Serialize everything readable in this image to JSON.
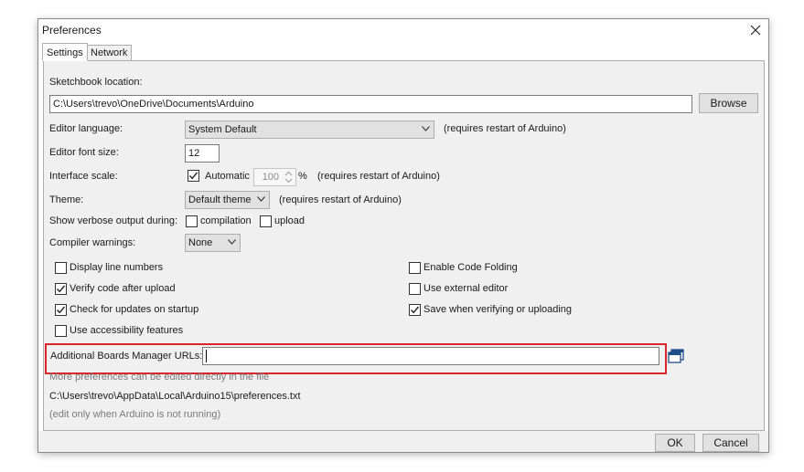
{
  "window": {
    "title": "Preferences"
  },
  "tabs": {
    "settings": "Settings",
    "network": "Network"
  },
  "sketchbook": {
    "label": "Sketchbook location:",
    "path": "C:\\Users\\trevo\\OneDrive\\Documents\\Arduino",
    "browse_label": "Browse"
  },
  "language": {
    "label": "Editor language:",
    "value": "System Default",
    "note": "(requires restart of Arduino)"
  },
  "font_size": {
    "label": "Editor font size:",
    "value": "12"
  },
  "interface_scale": {
    "label": "Interface scale:",
    "automatic_label": "Automatic",
    "automatic_checked": true,
    "value": "100",
    "unit": "%",
    "note": "(requires restart of Arduino)"
  },
  "theme": {
    "label": "Theme:",
    "value": "Default theme",
    "note": "(requires restart of Arduino)"
  },
  "verbose": {
    "label": "Show verbose output during:",
    "compilation_label": "compilation",
    "compilation_checked": false,
    "upload_label": "upload",
    "upload_checked": false
  },
  "warnings": {
    "label": "Compiler warnings:",
    "value": "None"
  },
  "options": {
    "display_line_numbers": {
      "label": "Display line numbers",
      "checked": false
    },
    "verify_after_upload": {
      "label": "Verify code after upload",
      "checked": true
    },
    "check_updates": {
      "label": "Check for updates on startup",
      "checked": true
    },
    "accessibility": {
      "label": "Use accessibility features",
      "checked": false
    },
    "code_folding": {
      "label": "Enable Code Folding",
      "checked": false
    },
    "external_editor": {
      "label": "Use external editor",
      "checked": false
    },
    "save_when_verifying": {
      "label": "Save when verifying or uploading",
      "checked": true
    }
  },
  "boards_manager": {
    "label": "Additional Boards Manager URLs:",
    "value": "",
    "icon": "window-list-icon"
  },
  "more_prefs": {
    "note": "More preferences can be edited directly in the file",
    "path": "C:\\Users\\trevo\\AppData\\Local\\Arduino15\\preferences.txt",
    "warning": "(edit only when Arduino is not running)"
  },
  "footer": {
    "ok_label": "OK",
    "cancel_label": "Cancel"
  },
  "colors": {
    "highlight": "#d9252b",
    "panel_bg": "#f0f0f0",
    "button_bg": "#e1e1e1"
  }
}
